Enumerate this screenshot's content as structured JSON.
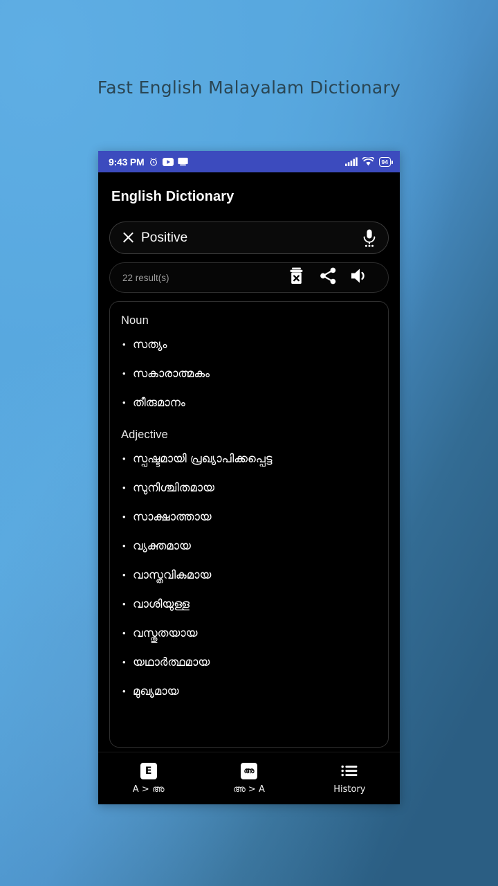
{
  "promo": {
    "headline": "Fast English Malayalam Dictionary",
    "background_start": "#5BAAE0",
    "background_end": "#2B5E83",
    "headline_color": "#2A4654"
  },
  "status_bar": {
    "time": "9:43 PM",
    "battery_level": "94",
    "icons": [
      "alarm-clock-icon",
      "youtube-icon",
      "cast-icon",
      "signal-bars-icon",
      "wifi-icon",
      "battery-icon"
    ],
    "background": "#3C4BBE"
  },
  "app": {
    "title": "English Dictionary"
  },
  "search": {
    "value": "Positive",
    "clear_icon": "close-icon",
    "mic_icon": "microphone-icon"
  },
  "results_bar": {
    "count_label": "22 result(s)",
    "actions": [
      {
        "name": "delete-button",
        "icon": "trash-x-icon"
      },
      {
        "name": "share-button",
        "icon": "share-icon"
      },
      {
        "name": "speak-button",
        "icon": "speaker-icon"
      }
    ]
  },
  "results": {
    "sections": [
      {
        "pos": "Noun",
        "senses": [
          "സത്യം",
          "സകാരാത്മകം",
          "തീരുമാനം"
        ]
      },
      {
        "pos": "Adjective",
        "senses": [
          "സ്പഷ്ടമായി പ്രഖ്യാപിക്കപ്പെട്ട",
          "സുനിശ്ചിതമായ",
          "സാക്ഷാത്തായ",
          "വ്യക്തമായ",
          "വാസ്തവികമായ",
          "വാശിയുള്ള",
          "വസ്തുതയായ",
          "യഥാർത്ഥമായ",
          "മുഖ്യമായ"
        ]
      }
    ]
  },
  "bottom_nav": {
    "tabs": [
      {
        "badge": "E",
        "label": "A > അ",
        "icon": "english-badge-icon"
      },
      {
        "badge": "അ",
        "label": "അ > A",
        "icon": "malayalam-badge-icon"
      },
      {
        "badge": "",
        "label": "History",
        "icon": "list-icon"
      }
    ]
  }
}
